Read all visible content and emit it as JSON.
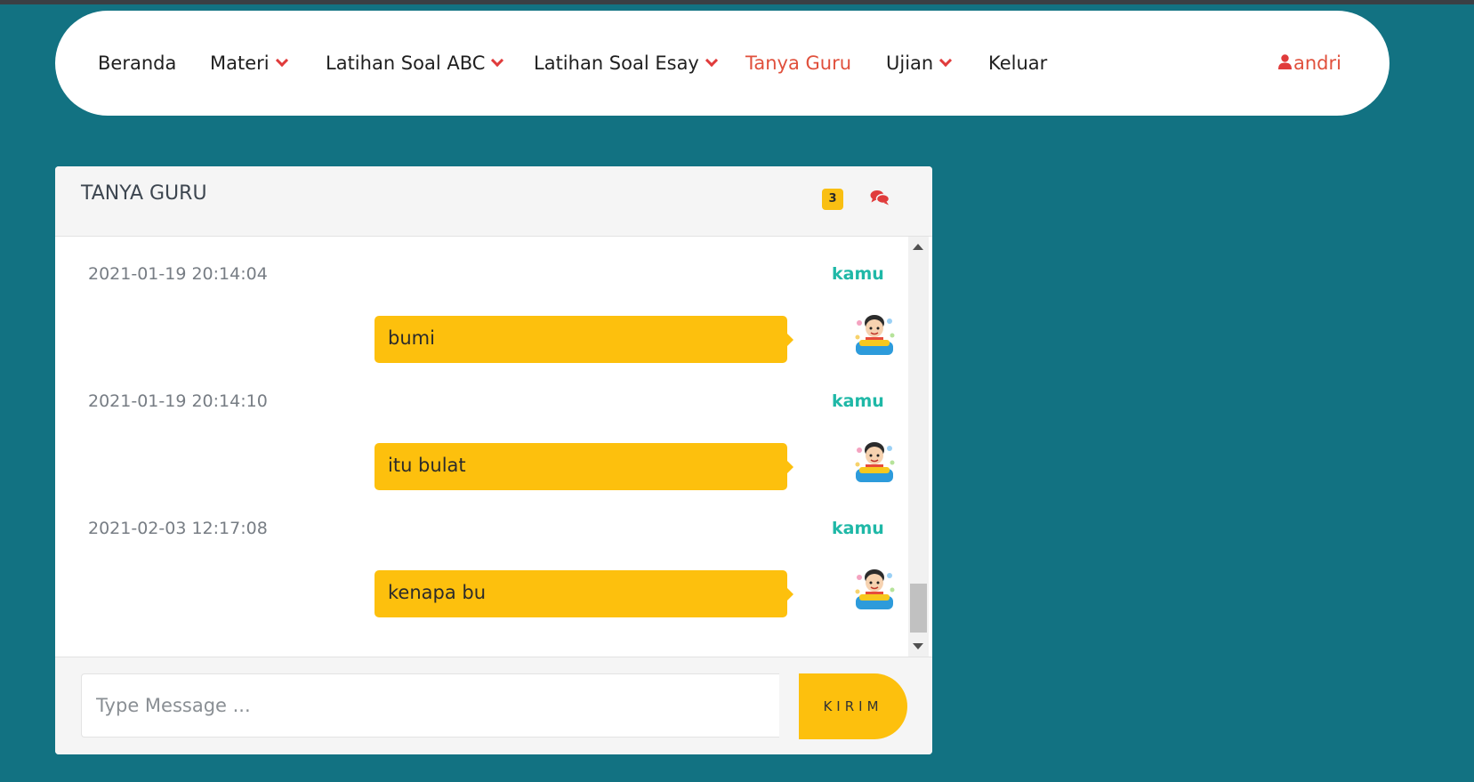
{
  "nav": {
    "items": [
      {
        "label": "Beranda"
      },
      {
        "label": "Materi"
      },
      {
        "label": "Latihan Soal ABC"
      },
      {
        "label": "Latihan Soal Esay"
      },
      {
        "label": "Tanya Guru"
      },
      {
        "label": "Ujian"
      },
      {
        "label": "Keluar"
      }
    ],
    "active_item": "Tanya Guru",
    "user": "andri"
  },
  "chat": {
    "title": "TANYA GURU",
    "badge_count": "3",
    "messages": [
      {
        "time": "2021-01-19 20:14:04",
        "author": "kamu",
        "text": "bumi"
      },
      {
        "time": "2021-01-19 20:14:10",
        "author": "kamu",
        "text": "itu bulat"
      },
      {
        "time": "2021-02-03 12:17:08",
        "author": "kamu",
        "text": "kenapa bu"
      }
    ],
    "input_placeholder": "Type Message ...",
    "send_label": "KIRIM"
  },
  "colors": {
    "background": "#127282",
    "accent": "#fdc00d",
    "active_nav": "#e0503c",
    "author": "#1fb8a7"
  },
  "icons": [
    "chevron-down-icon",
    "user-icon",
    "comments-icon",
    "avatar-image"
  ]
}
